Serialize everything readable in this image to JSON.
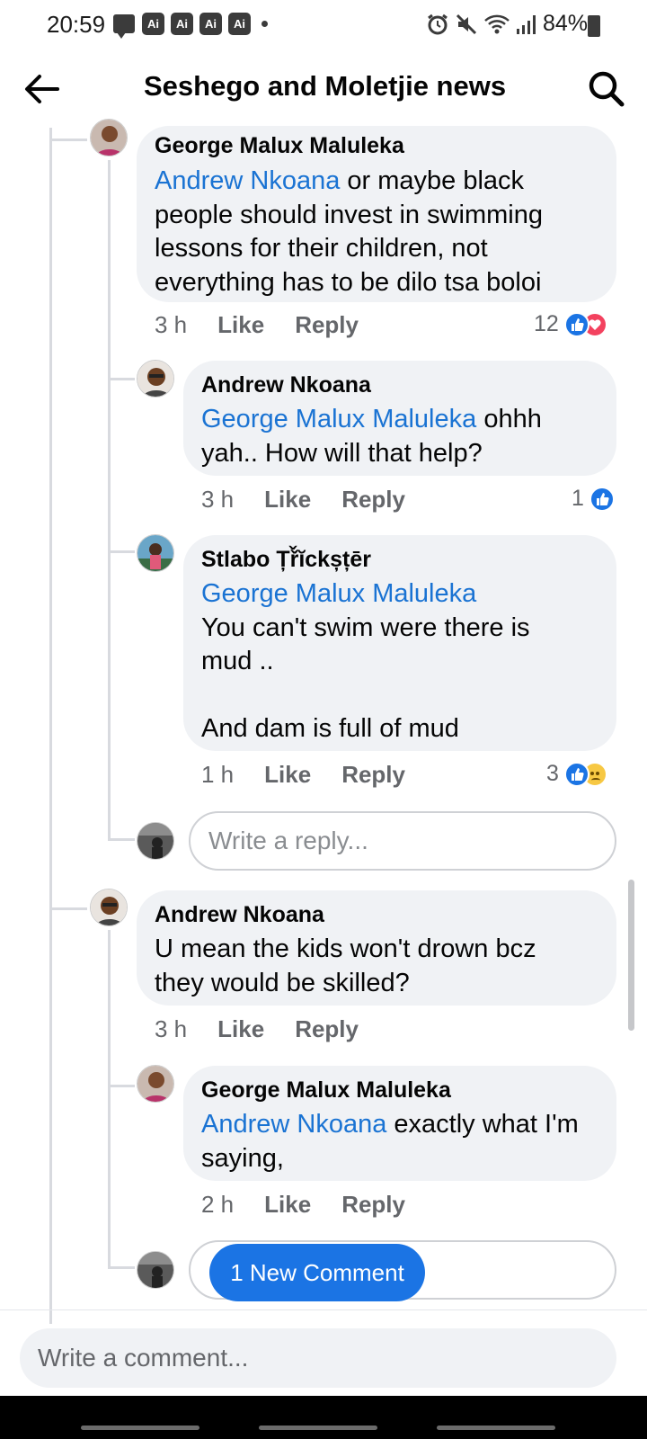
{
  "status_bar": {
    "time": "20:59",
    "ai_badges": [
      "Ai",
      "Ai",
      "Ai",
      "Ai"
    ],
    "battery": "84%"
  },
  "header": {
    "title": "Seshego and Moletjie news"
  },
  "comments": [
    {
      "author": "George Malux Maluleka",
      "mention": "Andrew Nkoana",
      "text": " or maybe black people should invest in swimming lessons for their children, not everything has to be dilo tsa boloi",
      "time": "3 h",
      "like_label": "Like",
      "reply_label": "Reply",
      "reaction_count": "12",
      "reactions": [
        "like-icon",
        "love-icon"
      ]
    },
    {
      "author": "Andrew Nkoana",
      "mention": "George Malux Maluleka",
      "text": " ohhh yah.. How will that help?",
      "time": "3 h",
      "like_label": "Like",
      "reply_label": "Reply",
      "reaction_count": "1",
      "reactions": [
        "like-icon"
      ]
    },
    {
      "author": "Stlabo Țř̌ĭckșțēr",
      "mention": "George Malux Maluleka",
      "text": "You can't swim were there is mud ..\n\nAnd dam is full of mud",
      "time": "1 h",
      "like_label": "Like",
      "reply_label": "Reply",
      "reaction_count": "3",
      "reactions": [
        "like-icon",
        "sad-icon"
      ]
    },
    {
      "author": "Andrew Nkoana",
      "mention": "",
      "text": "U mean the kids won't drown bcz they would be skilled?",
      "time": "3 h",
      "like_label": "Like",
      "reply_label": "Reply",
      "reaction_count": "",
      "reactions": []
    },
    {
      "author": "George Malux Maluleka",
      "mention": "Andrew Nkoana",
      "text": " exactly what I'm saying,",
      "time": "2 h",
      "like_label": "Like",
      "reply_label": "Reply",
      "reaction_count": "",
      "reactions": []
    }
  ],
  "reply_placeholder": "Write a reply...",
  "new_comment_label": "1 New Comment",
  "comment_placeholder": "Write a comment...",
  "colors": {
    "accent": "#1b74e4",
    "mention": "#1a73d3",
    "bubble": "#f0f2f5",
    "meta": "#65676b"
  }
}
